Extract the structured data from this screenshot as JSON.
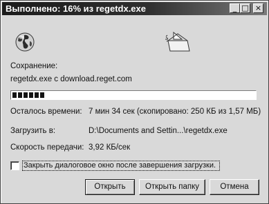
{
  "window": {
    "title": "Выполнено: 16% из regetdx.exe",
    "controls": {
      "minimize": "_",
      "maximize": "□",
      "close": "×"
    }
  },
  "icons": {
    "globe": "globe-icon",
    "folder": "folder-icon"
  },
  "status": {
    "saving_label": "Сохранение:",
    "saving_value": "regetdx.exe с download.reget.com",
    "progress_percent": 16
  },
  "details": {
    "time_left_label": "Осталось времени:",
    "time_left_value": "7 мин 34 сек (скопировано: 250 КБ из 1,57 МБ)",
    "download_to_label": "Загрузить в:",
    "download_to_value": "D:\\Documents and Settin...\\regetdx.exe",
    "speed_label": "Скорость передачи:",
    "speed_value": "3,92 КБ/сек"
  },
  "options": {
    "close_on_complete_label": "Закрыть диалоговое окно после завершения загрузки.",
    "close_on_complete_checked": false
  },
  "buttons": {
    "open": "Открыть",
    "open_folder": "Открыть папку",
    "cancel": "Отмена"
  }
}
